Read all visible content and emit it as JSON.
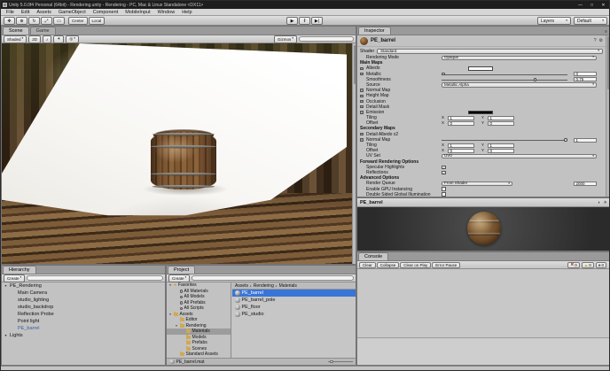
{
  "colors": {
    "selection_blue": "#3875d7",
    "prefab_blue": "#3a5c9c"
  },
  "titlebar": {
    "title": "Unity 5.0.0f4 Personal (64bit) - Rendering.unity - Rendering - PC, Mac & Linux Standalone <DX11>",
    "minimize_glyph": "—",
    "maximize_glyph": "□",
    "close_glyph": "✕"
  },
  "menubar": {
    "items": [
      "File",
      "Edit",
      "Assets",
      "GameObject",
      "Component",
      "MobileInput",
      "Window",
      "Help"
    ]
  },
  "toolbar": {
    "tools": [
      {
        "name": "hand-tool",
        "glyph": "✥"
      },
      {
        "name": "move-tool",
        "glyph": "⊕"
      },
      {
        "name": "rotate-tool",
        "glyph": "↻"
      },
      {
        "name": "scale-tool",
        "glyph": "⤢"
      },
      {
        "name": "rect-tool",
        "glyph": "▭"
      }
    ],
    "pivot_label": "Center",
    "space_label": "Local",
    "play_glyph": "▶",
    "pause_glyph": "‖",
    "step_glyph": "▶|",
    "layers_label": "Layers",
    "layout_label": "Default"
  },
  "scene": {
    "tabs": [
      {
        "label": "Scene",
        "active": true
      },
      {
        "label": "Game",
        "active": false
      }
    ],
    "toolbar": {
      "shading_label": "Shaded",
      "mode_2d_label": "2D",
      "audio_icon": "♪",
      "lighting_icon": "☀",
      "effects_icon": "◎",
      "gizmos_label": "Gizmos",
      "search_placeholder": ""
    }
  },
  "hierarchy": {
    "tab_label": "Hierarchy",
    "create_label": "Create",
    "items": [
      {
        "label": "PE_Rendering",
        "indent": 0,
        "expanded": true,
        "prefab": false
      },
      {
        "label": "Main Camera",
        "indent": 1,
        "prefab": false
      },
      {
        "label": "studio_lighting",
        "indent": 1,
        "prefab": false
      },
      {
        "label": "studio_backdrop",
        "indent": 1,
        "prefab": false
      },
      {
        "label": "Reflection Probe",
        "indent": 1,
        "prefab": false
      },
      {
        "label": "Point light",
        "indent": 1,
        "prefab": false
      },
      {
        "label": "PE_barrel",
        "indent": 1,
        "prefab": true
      },
      {
        "label": "Lights",
        "indent": 0,
        "expanded": true,
        "prefab": false
      }
    ]
  },
  "project": {
    "tab_label": "Project",
    "create_label": "Create",
    "tree": [
      {
        "label": "Favorites",
        "indent": 0,
        "icon": "star",
        "expanded": true
      },
      {
        "label": "All Materials",
        "indent": 1,
        "icon": "search"
      },
      {
        "label": "All Models",
        "indent": 1,
        "icon": "search"
      },
      {
        "label": "All Prefabs",
        "indent": 1,
        "icon": "search"
      },
      {
        "label": "All Scripts",
        "indent": 1,
        "icon": "search"
      },
      {
        "label": "Assets",
        "indent": 0,
        "icon": "folder",
        "expanded": true
      },
      {
        "label": "Editor",
        "indent": 1,
        "icon": "folder"
      },
      {
        "label": "Rendering",
        "indent": 1,
        "icon": "folder",
        "expanded": true
      },
      {
        "label": "Materials",
        "indent": 2,
        "icon": "folder",
        "selected": true
      },
      {
        "label": "Models",
        "indent": 2,
        "icon": "folder"
      },
      {
        "label": "Prefabs",
        "indent": 2,
        "icon": "folder"
      },
      {
        "label": "Scenes",
        "indent": 2,
        "icon": "folder"
      },
      {
        "label": "Standard Assets",
        "indent": 1,
        "icon": "folder"
      }
    ],
    "breadcrumb": [
      "Assets",
      "Rendering",
      "Materials"
    ],
    "files": [
      {
        "name": "PE_barrel",
        "selected": true
      },
      {
        "name": "PE_barrel_pole",
        "selected": false
      },
      {
        "name": "PE_floor",
        "selected": false
      },
      {
        "name": "PE_studio",
        "selected": false
      }
    ],
    "status_text": "PE_barrel.mat"
  },
  "inspector": {
    "tab_label": "Inspector",
    "name": "PE_barrel",
    "gear_icon": "⚙",
    "help_icon": "?",
    "shader_label": "Shader",
    "shader_value": "Standard",
    "rows": [
      {
        "type": "dropdown",
        "label": "Rendering Mode",
        "value": "Opaque"
      },
      {
        "type": "section",
        "label": "Main Maps"
      },
      {
        "type": "texture",
        "label": "Albedo",
        "swatch": "#ffffff"
      },
      {
        "type": "texslider",
        "label": "Metallic",
        "value": 0,
        "display": "0"
      },
      {
        "type": "slider",
        "label": "Smoothness",
        "value": 0.75,
        "display": "0.75"
      },
      {
        "type": "dropdown",
        "label": "Source",
        "value": "Metallic Alpha"
      },
      {
        "type": "texture",
        "label": "Normal Map"
      },
      {
        "type": "texture",
        "label": "Height Map"
      },
      {
        "type": "texture",
        "label": "Occlusion"
      },
      {
        "type": "texture",
        "label": "Detail Mask"
      },
      {
        "type": "texture",
        "label": "Emission",
        "swatch": "#000000"
      },
      {
        "type": "vector2",
        "label": "Tiling",
        "x": "1",
        "y": "1"
      },
      {
        "type": "vector2",
        "label": "Offset",
        "x": "0",
        "y": "0"
      },
      {
        "type": "section",
        "label": "Secondary Maps"
      },
      {
        "type": "texture",
        "label": "Detail Albedo x2"
      },
      {
        "type": "texslider",
        "label": "Normal Map",
        "value": 1,
        "display": "1"
      },
      {
        "type": "vector2",
        "label": "Tiling",
        "x": "1",
        "y": "1"
      },
      {
        "type": "vector2",
        "label": "Offset",
        "x": "0",
        "y": "0"
      },
      {
        "type": "dropdown",
        "label": "UV Set",
        "value": "UV0"
      },
      {
        "type": "section",
        "label": "Forward Rendering Options"
      },
      {
        "type": "check",
        "label": "Specular Highlights",
        "checked": true
      },
      {
        "type": "check",
        "label": "Reflections",
        "checked": true
      },
      {
        "type": "section",
        "label": "Advanced Options"
      },
      {
        "type": "queue",
        "label": "Render Queue",
        "value": "From Shader",
        "number": "2000"
      },
      {
        "type": "check",
        "label": "Enable GPU Instancing",
        "checked": false
      },
      {
        "type": "check",
        "label": "Double Sided Global Illumination",
        "checked": false
      }
    ]
  },
  "preview": {
    "title": "PE_barrel",
    "sphere_icon": "◐",
    "light_icon": "☀"
  },
  "console": {
    "tab_label": "Console",
    "buttons": [
      "Clear",
      "Collapse",
      "Clear on Play",
      "Error Pause"
    ],
    "counts": [
      {
        "name": "error-count",
        "glyph": "✖",
        "value": "0",
        "color": "#b23b2e"
      },
      {
        "name": "warning-count",
        "glyph": "▲",
        "value": "0",
        "color": "#c8a400"
      },
      {
        "name": "log-count",
        "glyph": "■",
        "value": "0",
        "color": "#666666"
      }
    ]
  }
}
